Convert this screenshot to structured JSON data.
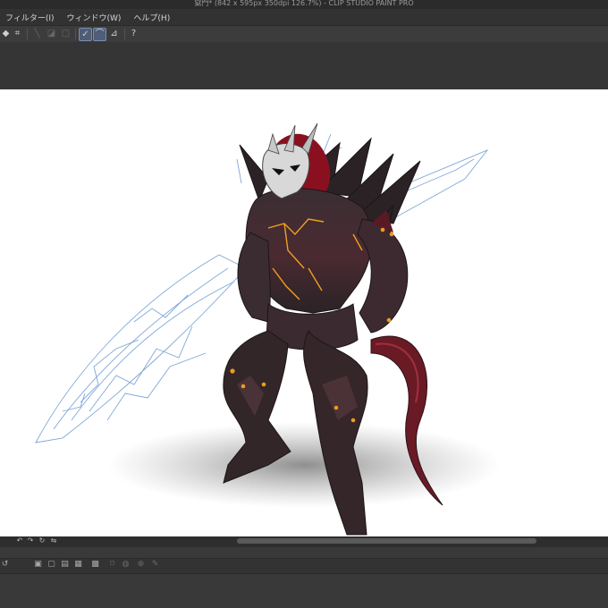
{
  "app": {
    "title": "獄門* (842 x 595px 350dpi 126.7%) - CLIP STUDIO PAINT PRO"
  },
  "menu": {
    "items": [
      {
        "label": "フィルター(I)"
      },
      {
        "label": "ウィンドウ(W)"
      },
      {
        "label": "ヘルプ(H)"
      }
    ]
  },
  "toolbar": {
    "icons": [
      "fill-icon",
      "crop-icon",
      "line-tool-icon",
      "gradient-icon",
      "fill-shape-icon",
      "vector-line-icon",
      "vector-curve-icon",
      "ruler-icon",
      "help-icon"
    ]
  },
  "canvas": {
    "artwork_subject": "armored dragon-knight with crystal sword sketch",
    "colors": {
      "armor": "#2f2629",
      "armor_highlight": "#5a4047",
      "crimson": "#8a1020",
      "glow": "#f0a020",
      "sword_sketch": "#7fa7d8",
      "skull": "#d8d8d8"
    }
  },
  "status": {
    "icons": [
      "rotate-left-icon",
      "rotate-right-icon",
      "reset-rotation-icon",
      "flip-icon"
    ]
  },
  "timeline": {
    "icons": [
      "loop-icon",
      "new-layer-icon",
      "new-vector-layer-icon",
      "folder-icon",
      "copy-icon",
      "merge-icon",
      "mask-icon",
      "visibility-icon",
      "edit-icon"
    ]
  }
}
